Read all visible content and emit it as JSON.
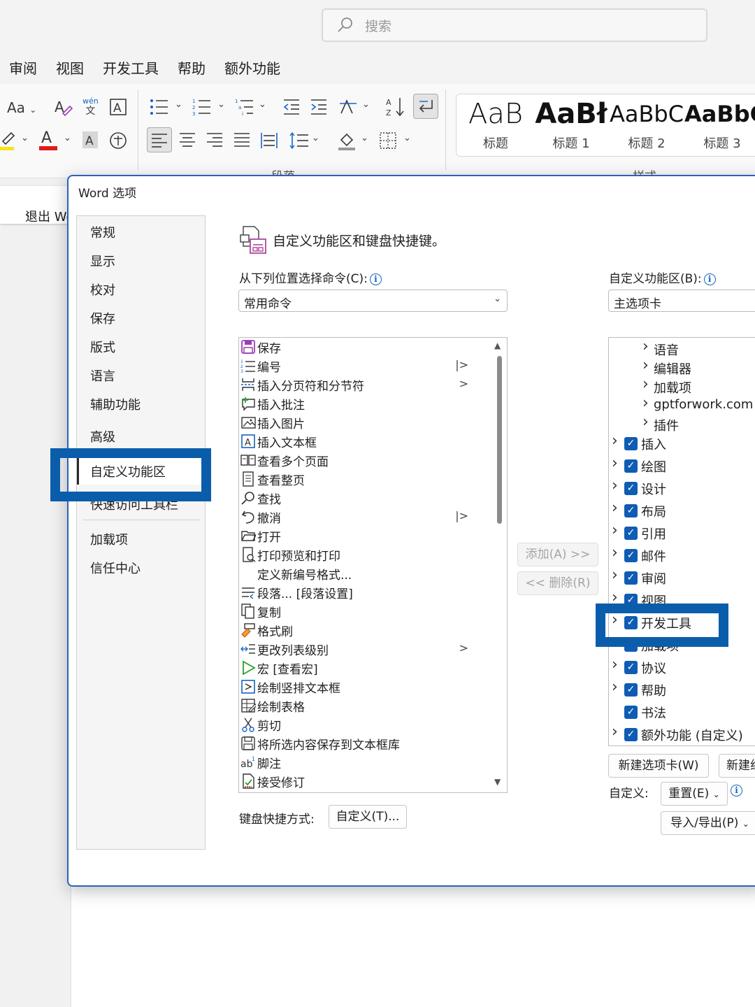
{
  "search": {
    "placeholder": "搜索"
  },
  "tabs": [
    "审阅",
    "视图",
    "开发工具",
    "帮助",
    "额外功能"
  ],
  "ribbon": {
    "font_labels": {
      "aa": "Aa",
      "wen_top": "wén",
      "wen_bottom": "文"
    },
    "group_paragraph": "段落",
    "group_styles": "样式",
    "styles": [
      {
        "sample": "AaB",
        "name": "标题"
      },
      {
        "sample": "AaBł",
        "name": "标题 1"
      },
      {
        "sample": "AaBbC",
        "name": "标题 2"
      },
      {
        "sample": "AaBbC",
        "name": "标题 3"
      }
    ]
  },
  "exit_word": "退出 Word",
  "dialog": {
    "title": "Word 选项",
    "nav": [
      "常规",
      "显示",
      "校对",
      "保存",
      "版式",
      "语言",
      "辅助功能",
      "高级",
      "自定义功能区",
      "快速访问工具栏",
      "加载项",
      "信任中心"
    ],
    "header": "自定义功能区和键盘快捷键。",
    "choose_label": "从下列位置选择命令(C):",
    "choose_value": "常用命令",
    "customize_label": "自定义功能区(B):",
    "customize_value": "主选项卡",
    "commands": [
      {
        "label": "保存",
        "icon": "save-icon",
        "sub": ""
      },
      {
        "label": "编号",
        "icon": "numbering-icon",
        "sub": "|>"
      },
      {
        "label": "插入分页符和分节符",
        "icon": "page-break-icon",
        "sub": ">"
      },
      {
        "label": "插入批注",
        "icon": "comment-icon",
        "sub": ""
      },
      {
        "label": "插入图片",
        "icon": "picture-icon",
        "sub": ""
      },
      {
        "label": "插入文本框",
        "icon": "textbox-icon",
        "sub": ""
      },
      {
        "label": "查看多个页面",
        "icon": "multi-page-icon",
        "sub": ""
      },
      {
        "label": "查看整页",
        "icon": "one-page-icon",
        "sub": ""
      },
      {
        "label": "查找",
        "icon": "find-icon",
        "sub": ""
      },
      {
        "label": "撤消",
        "icon": "undo-icon",
        "sub": "|>"
      },
      {
        "label": "打开",
        "icon": "open-folder-icon",
        "sub": ""
      },
      {
        "label": "打印预览和打印",
        "icon": "print-preview-icon",
        "sub": ""
      },
      {
        "label": "定义新编号格式...",
        "icon": "",
        "sub": ""
      },
      {
        "label": "段落... [段落设置]",
        "icon": "paragraph-icon",
        "sub": ""
      },
      {
        "label": "复制",
        "icon": "copy-icon",
        "sub": ""
      },
      {
        "label": "格式刷",
        "icon": "format-painter-icon",
        "sub": ""
      },
      {
        "label": "更改列表级别",
        "icon": "list-level-icon",
        "sub": ">"
      },
      {
        "label": "宏 [查看宏]",
        "icon": "macro-icon",
        "sub": ""
      },
      {
        "label": "绘制竖排文本框",
        "icon": "vertical-textbox-icon",
        "sub": ""
      },
      {
        "label": "绘制表格",
        "icon": "draw-table-icon",
        "sub": ""
      },
      {
        "label": "剪切",
        "icon": "cut-icon",
        "sub": ""
      },
      {
        "label": "将所选内容保存到文本框库",
        "icon": "save-gallery-icon",
        "sub": ""
      },
      {
        "label": "脚注",
        "icon": "footnote-icon",
        "sub": ""
      },
      {
        "label": "接受修订",
        "icon": "accept-change-icon",
        "sub": ""
      }
    ],
    "add_button": "添加(A) >>",
    "remove_button": "<< 删除(R)",
    "tree": [
      {
        "label": "语音",
        "child": true,
        "checked": false,
        "expand": true
      },
      {
        "label": "编辑器",
        "child": true,
        "checked": false,
        "expand": true
      },
      {
        "label": "加载项",
        "child": true,
        "checked": false,
        "expand": true
      },
      {
        "label": "gptforwork.com",
        "child": true,
        "checked": false,
        "expand": true
      },
      {
        "label": "插件",
        "child": true,
        "checked": false,
        "expand": true
      },
      {
        "label": "插入",
        "child": false,
        "checked": true,
        "expand": true
      },
      {
        "label": "绘图",
        "child": false,
        "checked": true,
        "expand": true
      },
      {
        "label": "设计",
        "child": false,
        "checked": true,
        "expand": true
      },
      {
        "label": "布局",
        "child": false,
        "checked": true,
        "expand": true
      },
      {
        "label": "引用",
        "child": false,
        "checked": true,
        "expand": true
      },
      {
        "label": "邮件",
        "child": false,
        "checked": true,
        "expand": true
      },
      {
        "label": "审阅",
        "child": false,
        "checked": true,
        "expand": true
      },
      {
        "label": "视图",
        "child": false,
        "checked": true,
        "expand": true
      },
      {
        "label": "开发工具",
        "child": false,
        "checked": true,
        "expand": true
      },
      {
        "label": "加载项",
        "child": false,
        "checked": true,
        "expand": false
      },
      {
        "label": "协议",
        "child": false,
        "checked": true,
        "expand": true
      },
      {
        "label": "帮助",
        "child": false,
        "checked": true,
        "expand": true
      },
      {
        "label": "书法",
        "child": false,
        "checked": true,
        "expand": false
      },
      {
        "label": "额外功能 (自定义)",
        "child": false,
        "checked": true,
        "expand": true
      }
    ],
    "new_tab_button": "新建选项卡(W)",
    "new_group_button": "新建组",
    "customize_text": "自定义:",
    "reset_button": "重置(E)",
    "import_export_button": "导入/导出(P)",
    "keyboard_label": "键盘快捷方式:",
    "keyboard_button": "自定义(T)..."
  },
  "colors": {
    "highlight": "#0a5dab",
    "checkbox": "#0f5cb4",
    "dialog_border": "#2a63b8"
  }
}
